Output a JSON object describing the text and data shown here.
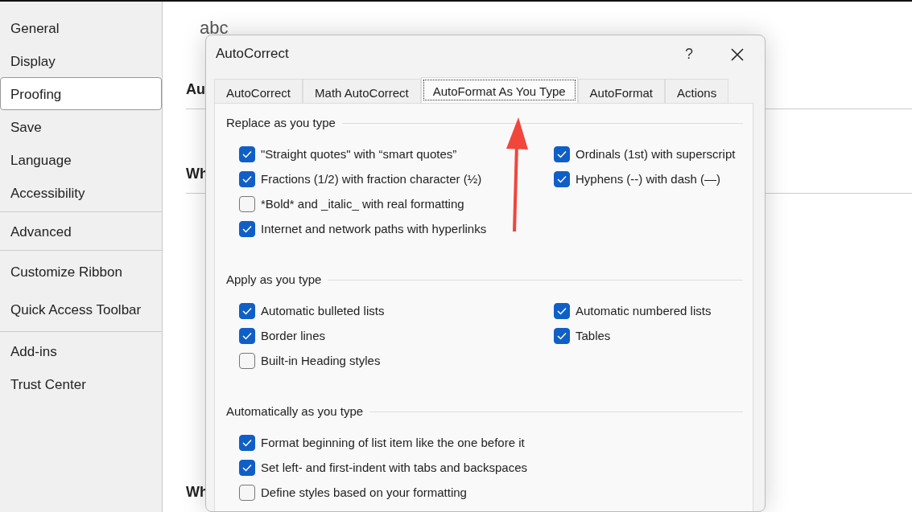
{
  "sidebar": {
    "groups": [
      [
        {
          "label": "General",
          "selected": false
        },
        {
          "label": "Display",
          "selected": false
        },
        {
          "label": "Proofing",
          "selected": true
        },
        {
          "label": "Save",
          "selected": false
        },
        {
          "label": "Language",
          "selected": false
        },
        {
          "label": "Accessibility",
          "selected": false
        }
      ],
      [
        {
          "label": "Advanced",
          "selected": false
        }
      ],
      [
        {
          "label": "Customize Ribbon",
          "selected": false
        },
        {
          "label": "Quick Access Toolbar",
          "selected": false
        }
      ],
      [
        {
          "label": "Add-ins",
          "selected": false
        },
        {
          "label": "Trust Center",
          "selected": false
        }
      ]
    ]
  },
  "background": {
    "icon_text": "abc",
    "headings": [
      "Au",
      "Wh",
      "Wh"
    ]
  },
  "dialog": {
    "title": "AutoCorrect",
    "help": "?",
    "tabs": [
      {
        "label": "AutoCorrect",
        "selected": false
      },
      {
        "label": "Math AutoCorrect",
        "selected": false
      },
      {
        "label": "AutoFormat As You Type",
        "selected": true
      },
      {
        "label": "AutoFormat",
        "selected": false
      },
      {
        "label": "Actions",
        "selected": false
      }
    ],
    "groups": [
      {
        "title": "Replace as you type",
        "left": [
          {
            "label": "\"Straight quotes\" with “smart quotes”",
            "checked": true
          },
          {
            "label": "Fractions (1/2) with fraction character (½)",
            "checked": true
          },
          {
            "label": "*Bold* and _italic_ with real formatting",
            "checked": false
          },
          {
            "label": "Internet and network paths with hyperlinks",
            "checked": true
          }
        ],
        "right": [
          {
            "label": "Ordinals (1st) with superscript",
            "checked": true
          },
          {
            "label": "Hyphens (--) with dash (—)",
            "checked": true
          }
        ]
      },
      {
        "title": "Apply as you type",
        "left": [
          {
            "label": "Automatic bulleted lists",
            "checked": true
          },
          {
            "label": "Border lines",
            "checked": true
          },
          {
            "label": "Built-in Heading styles",
            "checked": false
          }
        ],
        "right": [
          {
            "label": "Automatic numbered lists",
            "checked": true
          },
          {
            "label": "Tables",
            "checked": true
          }
        ]
      },
      {
        "title": "Automatically as you type",
        "left": [
          {
            "label": "Format beginning of list item like the one before it",
            "checked": true
          },
          {
            "label": "Set left- and first-indent with tabs and backspaces",
            "checked": true
          },
          {
            "label": "Define styles based on your formatting",
            "checked": false
          }
        ]
      }
    ]
  }
}
